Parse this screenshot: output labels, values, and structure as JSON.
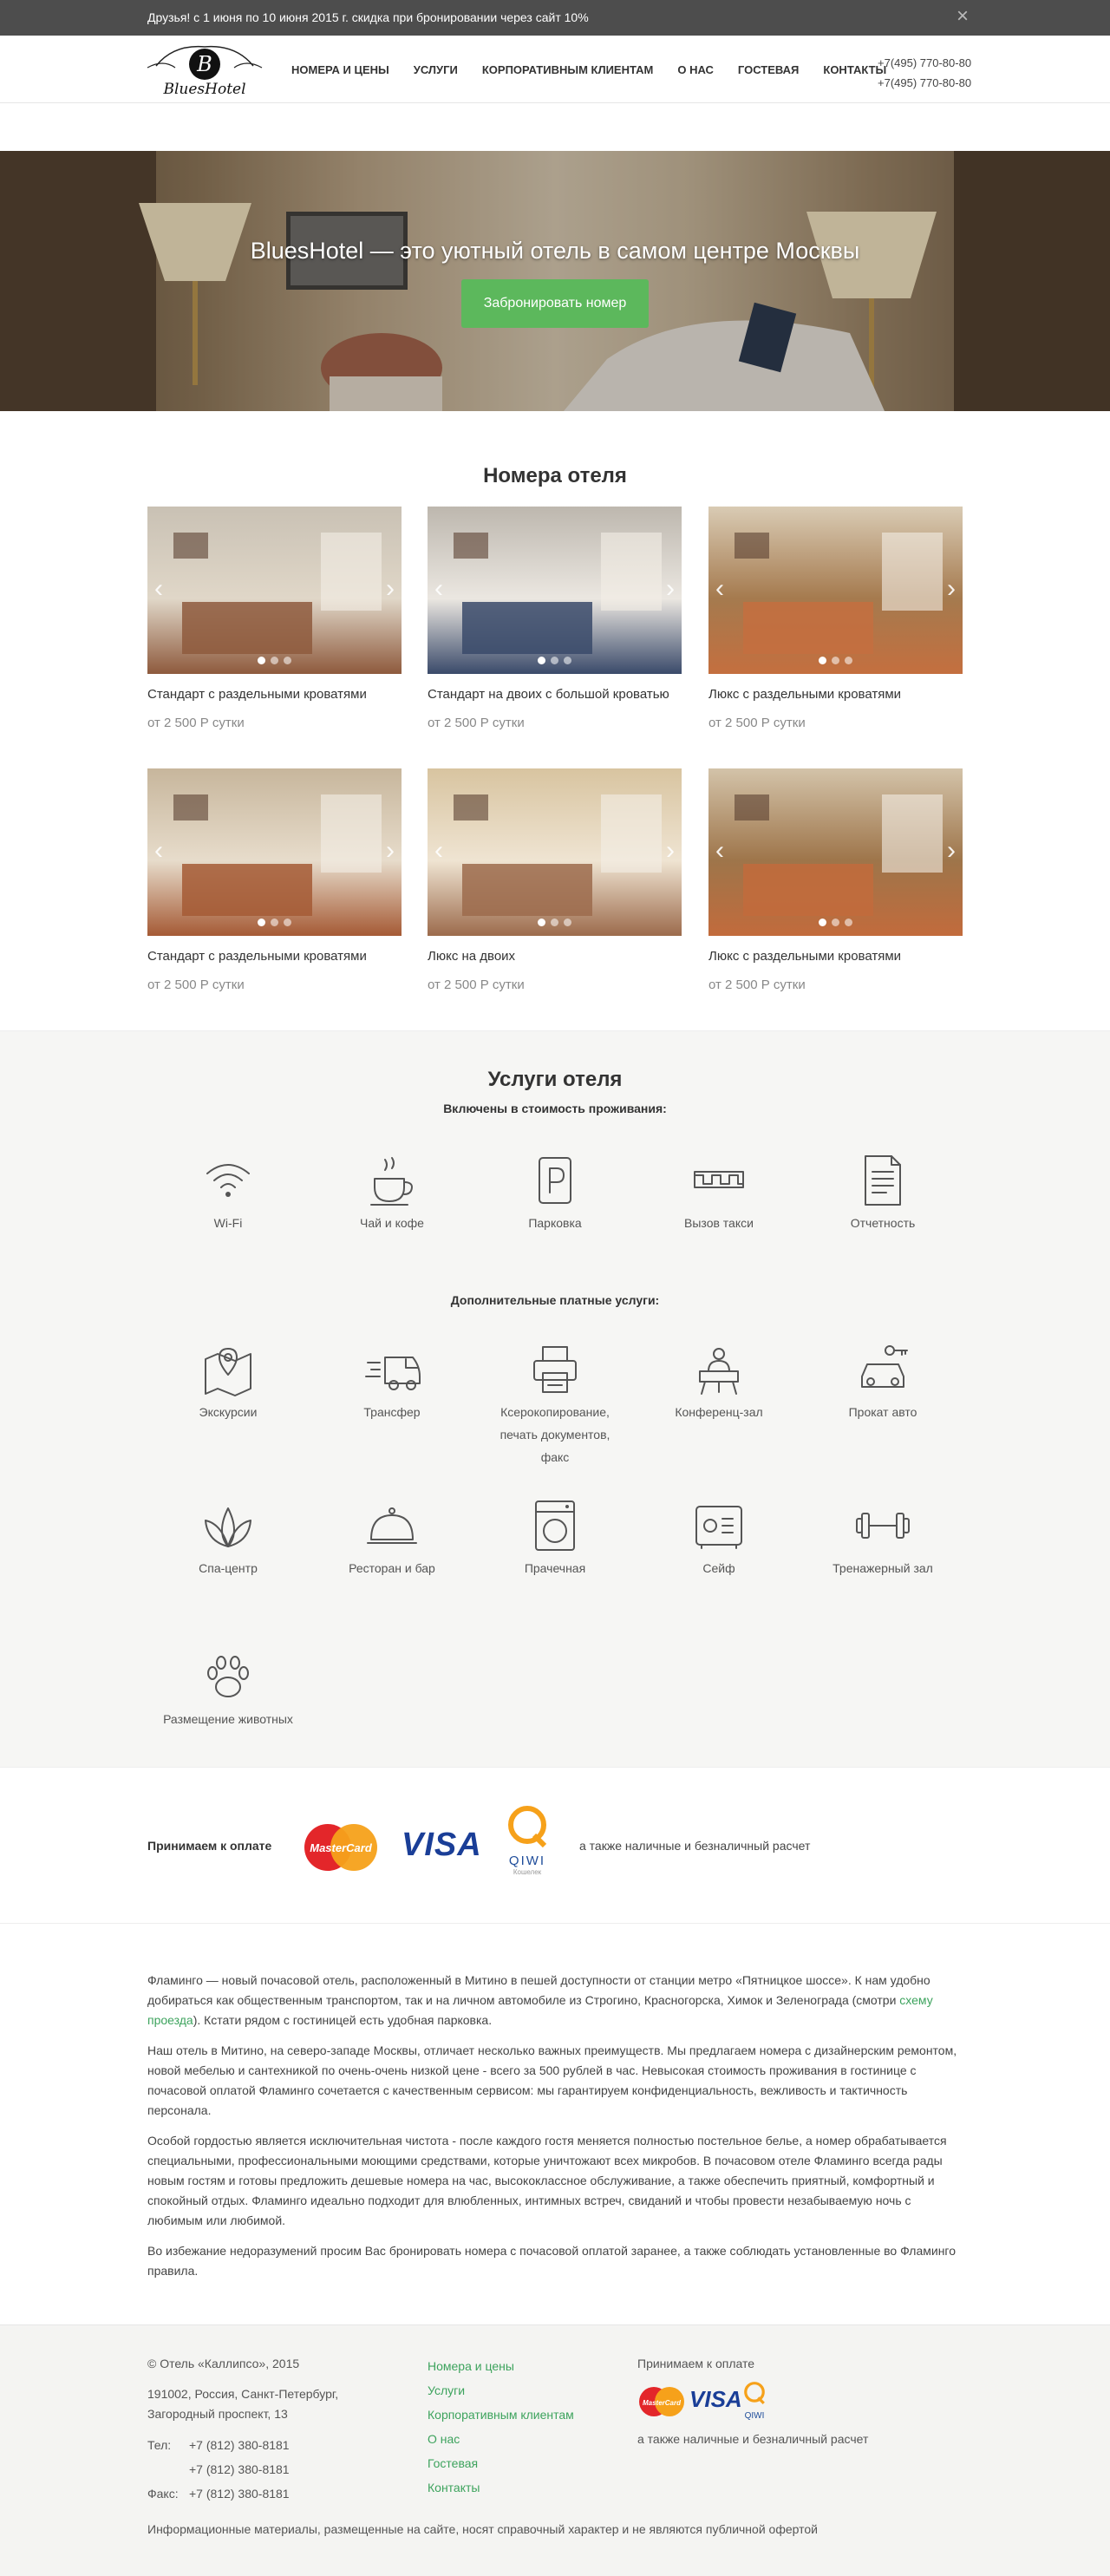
{
  "promo": {
    "text": "Друзья! с 1 июня по 10 июня 2015 г. скидка при бронировании через сайт 10%",
    "close": "×"
  },
  "header": {
    "logo_text": "BluesHotel",
    "logo_letter": "B",
    "nav": [
      "НОМЕРА И ЦЕНЫ",
      "УСЛУГИ",
      "КОРПОРАТИВНЫМ КЛИЕНТАМ",
      "О НАС",
      "ГОСТЕВАЯ",
      "КОНТАКТЫ"
    ],
    "phones": [
      "+7(495) 770-80-80",
      "+7(495) 770-80-80"
    ]
  },
  "hero": {
    "title": "BluesHotel — это уютный отель в самом центре Москвы",
    "button": "Забронировать номер"
  },
  "rooms": {
    "title": "Номера отеля",
    "items": [
      {
        "name": "Стандарт с раздельными кроватями",
        "price": "от 2 500 Р сутки"
      },
      {
        "name": "Стандарт на двоих с большой кроватью",
        "price": "от 2 500 Р сутки"
      },
      {
        "name": "Люкс с раздельными кроватями",
        "price": "от 2 500 Р сутки"
      },
      {
        "name": "Стандарт с раздельными кроватями",
        "price": "от 2 500 Р сутки"
      },
      {
        "name": "Люкс на двоих",
        "price": "от 2 500 Р сутки"
      },
      {
        "name": "Люкс с раздельными кроватями",
        "price": "от 2 500 Р сутки"
      }
    ]
  },
  "services": {
    "title": "Услуги отеля",
    "included_title": "Включены в стоимость проживания:",
    "included": [
      "Wi-Fi",
      "Чай и кофе",
      "Парковка",
      "Вызов такси",
      "Отчетность"
    ],
    "paid_title": "Дополнительные платные услуги:",
    "paid": [
      "Экскурсии",
      "Трансфер",
      "Ксерокопирование, печать документов, факс",
      "Конференц-зал",
      "Прокат авто",
      "Спа-центр",
      "Ресторан и бар",
      "Прачечная",
      "Сейф",
      "Тренажерный зал",
      "Размещение животных"
    ]
  },
  "payment": {
    "label": "Принимаем к оплате",
    "mastercard": "MasterCard",
    "visa": "VISA",
    "qiwi": "QIWI",
    "qiwi_sub": "Кошелек",
    "also": "а также наличные и безналичный расчет"
  },
  "about": {
    "p1_a": "Фламинго — новый почасовой отель, расположенный в Митино в пешей доступности от станции метро «Пятницкое шоссе». К нам удобно добираться как общественным транспортом, так и на личном автомобиле из Строгино, Красногорска, Химок и Зеленограда (смотри ",
    "p1_link": "схему проезда",
    "p1_b": "). Кстати рядом с гостиницей есть удобная парковка.",
    "p2": "Наш отель в Митино, на северо-западе Москвы, отличает несколько важных преимуществ. Мы предлагаем номера с дизайнерским ремонтом, новой мебелью и сантехникой по очень-очень низкой цене - всего за 500 рублей в час. Невысокая стоимость проживания в гостинице с почасовой оплатой Фламинго сочетается с качественным сервисом: мы гарантируем конфиденциальность, вежливость и тактичность персонала.",
    "p3": "Особой гордостью является исключительная чистота - после каждого гостя меняется полностью постельное белье, а номер обрабатывается специальными, профессиональными моющими средствами, которые уничтожают всех микробов. В почасовом отеле Фламинго всегда рады новым гостям и готовы предложить дешевые номера на час, высококлассное обслуживание, а также обеспечить приятный, комфортный и спокойный отдых. Фламинго идеально подходит для влюбленных, интимных встреч, свиданий и чтобы провести незабываемую ночь с любимым или любимой.",
    "p4": "Во избежание недоразумений просим Вас бронировать номера с почасовой оплатой заранее, а также соблюдать установленные во Фламинго правила."
  },
  "footer": {
    "copyright": "© Отель «Каллипсо», 2015",
    "address1": "191002, Россия, Санкт-Петербург,",
    "address2": "Загородный проспект, 13",
    "tel_label": "Тел:",
    "fax_label": "Факс:",
    "tel1": "+7 (812) 380-8181",
    "tel2": "+7 (812) 380-8181",
    "fax": "+7 (812) 380-8181",
    "links": [
      "Номера и цены",
      "Услуги",
      "Корпоративным клиентам",
      "О нас",
      "Гостевая",
      "Контакты"
    ],
    "pay_label": "Принимаем к оплате",
    "also": "а также наличные и безналичный расчет",
    "disclaimer": "Информационные материалы, размещенные на сайте, носят справочный характер и не являются публичной офертой"
  },
  "colors": {
    "accent": "#5cb85c",
    "link": "#3da35d",
    "topbar": "#4d4d4d"
  }
}
